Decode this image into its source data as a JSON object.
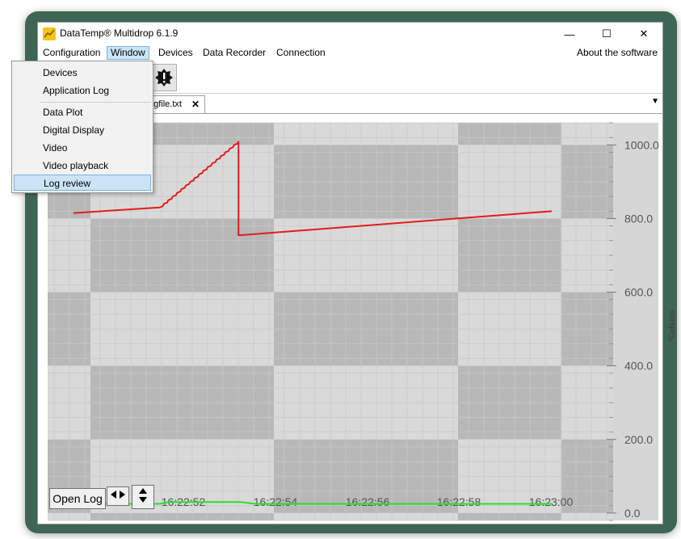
{
  "app": {
    "title": "DataTemp® Multidrop 6.1.9",
    "window_controls": {
      "minimize": "—",
      "maximize": "☐",
      "close": "✕"
    }
  },
  "menubar": {
    "items": [
      "Configuration",
      "Window",
      "Devices",
      "Data Recorder",
      "Connection"
    ],
    "active": "Window",
    "about": "About the software"
  },
  "tabs": [
    {
      "label": "ogfile.txt",
      "close": "✕"
    }
  ],
  "window_menu": {
    "items": [
      "Devices",
      "Application Log",
      "Data Plot",
      "Digital Display",
      "Video",
      "Video playback",
      "Log review"
    ],
    "selected": "Log review"
  },
  "bottom": {
    "open_log": "Open Log",
    "pan_icon": "horizontal-arrows-icon",
    "scale_icon": "vertical-arrows-icon"
  },
  "chart_data": {
    "type": "line",
    "ylabel": "°Celsius",
    "ylim": [
      -20,
      1060
    ],
    "yticks": [
      "0.0",
      "200.0",
      "400.0",
      "600.0",
      "800.0",
      "1000.0"
    ],
    "xticks": [
      "16:22:52",
      "16:22:54",
      "16:22:56",
      "16:22:58",
      "16:23:00"
    ],
    "xlim": [
      0,
      10
    ],
    "colors": {
      "red": "#e21c1c",
      "green": "#29e029"
    },
    "series": [
      {
        "color": "#e21c1c",
        "x": [
          0.0,
          1.8,
          3.45,
          3.45,
          3.5,
          10.0
        ],
        "y": [
          815,
          830,
          1010,
          755,
          755,
          820
        ]
      },
      {
        "color": "#29e029",
        "x": [
          0.0,
          1.8,
          2.0,
          3.5,
          3.8,
          10.0
        ],
        "y": [
          25,
          25,
          30,
          30,
          25,
          25
        ]
      }
    ]
  }
}
